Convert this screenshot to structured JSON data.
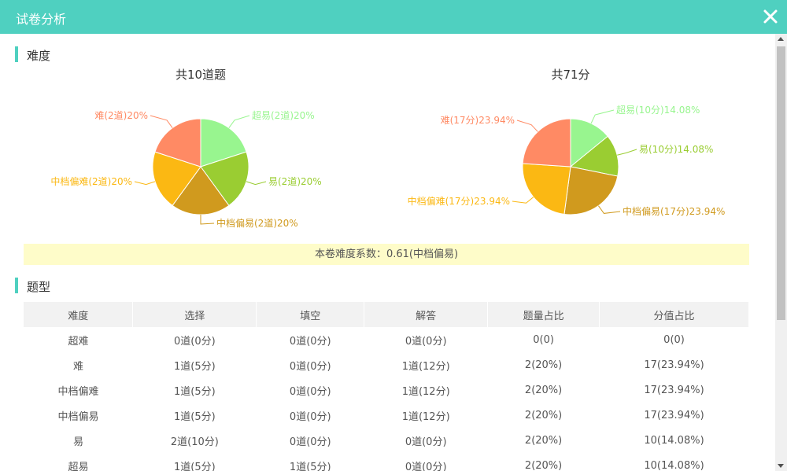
{
  "dialog": {
    "title": "试卷分析",
    "close_icon": "close-icon"
  },
  "difficulty_section": {
    "heading": "难度"
  },
  "question_type_section": {
    "heading": "题型"
  },
  "coefficient_text": "本卷难度系数：0.61(中档偏易)",
  "colors": {
    "accent": "#4fd0c0",
    "超难": "#98f58f",
    "难": "#ff8a64",
    "中档偏难": "#fbb813",
    "中档偏易": "#d09a1e",
    "易": "#9acd32"
  },
  "chart_data": [
    {
      "type": "pie",
      "title": "共10道题",
      "slices": [
        {
          "category": "超难",
          "label": "超易(2道)20%",
          "value": 20,
          "color": "#98f58f"
        },
        {
          "category": "易",
          "label": "易(2道)20%",
          "value": 20,
          "color": "#9acd32"
        },
        {
          "category": "中档偏易",
          "label": "中档偏易(2道)20%",
          "value": 20,
          "color": "#d09a1e"
        },
        {
          "category": "中档偏难",
          "label": "中档偏难(2道)20%",
          "value": 20,
          "color": "#fbb813"
        },
        {
          "category": "难",
          "label": "难(2道)20%",
          "value": 20,
          "color": "#ff8a64"
        }
      ]
    },
    {
      "type": "pie",
      "title": "共71分",
      "slices": [
        {
          "category": "超难",
          "label": "超易(10分)14.08%",
          "value": 14.08,
          "color": "#98f58f"
        },
        {
          "category": "易",
          "label": "易(10分)14.08%",
          "value": 14.08,
          "color": "#9acd32"
        },
        {
          "category": "中档偏易",
          "label": "中档偏易(17分)23.94%",
          "value": 23.94,
          "color": "#d09a1e"
        },
        {
          "category": "中档偏难",
          "label": "中档偏难(17分)23.94%",
          "value": 23.94,
          "color": "#fbb813"
        },
        {
          "category": "难",
          "label": "难(17分)23.94%",
          "value": 23.94,
          "color": "#ff8a64"
        }
      ]
    }
  ],
  "table": {
    "headers": [
      "难度",
      "选择",
      "填空",
      "解答",
      "题量占比",
      "分值占比"
    ],
    "rows": [
      [
        "超难",
        "0道(0分)",
        "0道(0分)",
        "0道(0分)",
        "0(0)",
        "0(0)"
      ],
      [
        "难",
        "1道(5分)",
        "0道(0分)",
        "1道(12分)",
        "2(20%)",
        "17(23.94%)"
      ],
      [
        "中档偏难",
        "1道(5分)",
        "0道(0分)",
        "1道(12分)",
        "2(20%)",
        "17(23.94%)"
      ],
      [
        "中档偏易",
        "1道(5分)",
        "0道(0分)",
        "1道(12分)",
        "2(20%)",
        "17(23.94%)"
      ],
      [
        "易",
        "2道(10分)",
        "0道(0分)",
        "0道(0分)",
        "2(20%)",
        "10(14.08%)"
      ],
      [
        "超易",
        "1道(5分)",
        "1道(5分)",
        "0道(0分)",
        "2(20%)",
        "10(14.08%)"
      ]
    ]
  }
}
